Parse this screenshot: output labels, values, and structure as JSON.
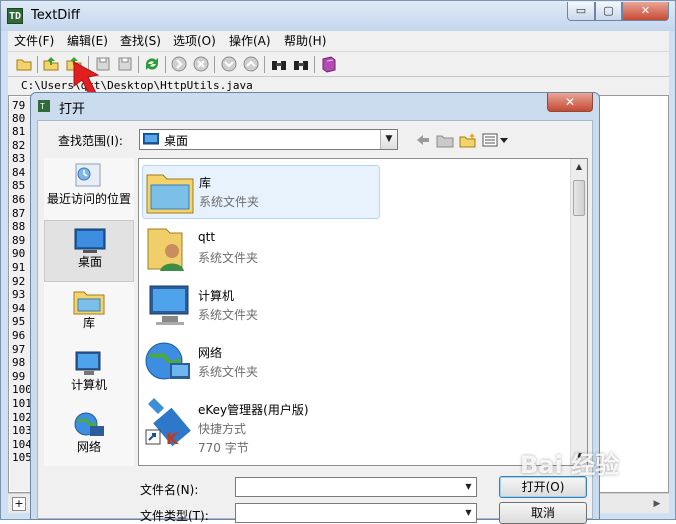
{
  "app": {
    "title": "TextDiff",
    "icon_label": "TD",
    "file_path": "C:\\Users\\qtt\\Desktop\\HttpUtils.java"
  },
  "window_controls": {
    "minimize": "▭",
    "maximize": "▢",
    "close": "✕"
  },
  "menu": [
    "文件(F)",
    "编辑(E)",
    "查找(S)",
    "选项(O)",
    "操作(A)",
    "帮助(H)"
  ],
  "line_numbers": [
    "79",
    "80",
    "81",
    "82",
    "83",
    "84",
    "85",
    "86",
    "87",
    "88",
    "89",
    "90",
    "91",
    "92",
    "93",
    "94",
    "95",
    "96",
    "97",
    "98",
    "99",
    "100",
    "101",
    "102",
    "103",
    "104",
    "105"
  ],
  "bottom_bar": {
    "expand": "+"
  },
  "dialog": {
    "title": "打开",
    "close": "✕",
    "look_in_label": "查找范围(I):",
    "look_in_value": "桌面",
    "places": [
      {
        "label": "最近访问的位置",
        "icon": "recent-places-icon"
      },
      {
        "label": "桌面",
        "icon": "desktop-icon"
      },
      {
        "label": "库",
        "icon": "library-icon"
      },
      {
        "label": "计算机",
        "icon": "computer-icon"
      },
      {
        "label": "网络",
        "icon": "network-icon"
      }
    ],
    "files": [
      {
        "name": "库",
        "type": "系统文件夹",
        "icon": "library-folder-icon"
      },
      {
        "name": "qtt",
        "type": "系统文件夹",
        "icon": "user-folder-icon"
      },
      {
        "name": "计算机",
        "type": "系统文件夹",
        "icon": "computer-icon"
      },
      {
        "name": "网络",
        "type": "系统文件夹",
        "icon": "network-icon"
      },
      {
        "name": "eKey管理器(用户版)",
        "type": "快捷方式",
        "extra": "770 字节",
        "icon": "ekey-shortcut-icon"
      }
    ],
    "filename_label": "文件名(N):",
    "filename_value": "",
    "filetype_label": "文件类型(T):",
    "filetype_value": "",
    "open_button": "打开(O)",
    "cancel_button": "取消"
  },
  "watermark": "Bai 经验",
  "colors": {
    "accent": "#3c7fb1",
    "titlebar": "#cbdcef",
    "close": "#c74a34",
    "arrow": "#e02020"
  }
}
